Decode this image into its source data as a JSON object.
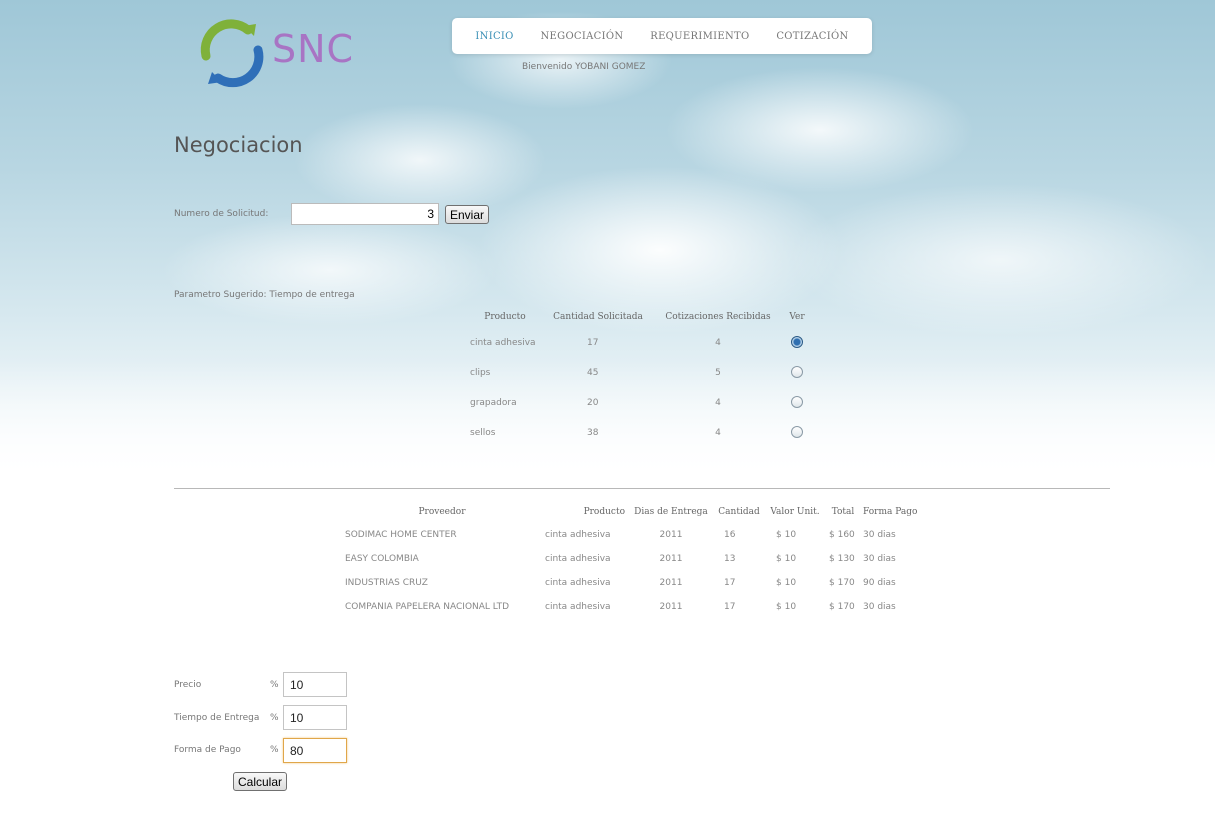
{
  "logo": {
    "text": "SNC"
  },
  "nav": {
    "items": [
      {
        "label": "INICIO",
        "active": true
      },
      {
        "label": "NEGOCIACIÓN"
      },
      {
        "label": "REQUERIMIENTO"
      },
      {
        "label": "COTIZACIÓN"
      }
    ],
    "welcome": "Bienvenido YOBANI GOMEZ"
  },
  "page": {
    "title": "Negociacion"
  },
  "solicitud": {
    "label": "Numero de Solicitud:",
    "value": "3",
    "button": "Enviar"
  },
  "param": {
    "text": "Parametro Sugerido: Tiempo de entrega"
  },
  "productos": {
    "headers": [
      "Producto",
      "Cantidad Solicitada",
      "Cotizaciones Recibidas",
      "Ver"
    ],
    "rows": [
      {
        "producto": "cinta adhesiva",
        "cantidad": "17",
        "cotizaciones": "4",
        "selected": true
      },
      {
        "producto": "clips",
        "cantidad": "45",
        "cotizaciones": "5",
        "selected": false
      },
      {
        "producto": "grapadora",
        "cantidad": "20",
        "cotizaciones": "4",
        "selected": false
      },
      {
        "producto": "sellos",
        "cantidad": "38",
        "cotizaciones": "4",
        "selected": false
      }
    ]
  },
  "cotizaciones": {
    "headers": [
      "Proveedor",
      "Producto",
      "Dias de Entrega",
      "Cantidad",
      "Valor Unit.",
      "Total",
      "Forma Pago"
    ],
    "rows": [
      {
        "proveedor": "SODIMAC HOME CENTER",
        "producto": "cinta adhesiva",
        "dias": "2011",
        "cantidad": "16",
        "valor": "$ 10",
        "total": "$ 160",
        "forma": "30 dias"
      },
      {
        "proveedor": "EASY COLOMBIA",
        "producto": "cinta adhesiva",
        "dias": "2011",
        "cantidad": "13",
        "valor": "$ 10",
        "total": "$ 130",
        "forma": "30 dias"
      },
      {
        "proveedor": "INDUSTRIAS CRUZ",
        "producto": "cinta adhesiva",
        "dias": "2011",
        "cantidad": "17",
        "valor": "$ 10",
        "total": "$ 170",
        "forma": "90 dias"
      },
      {
        "proveedor": "COMPANIA PAPELERA NACIONAL LTD",
        "producto": "cinta adhesiva",
        "dias": "2011",
        "cantidad": "17",
        "valor": "$ 10",
        "total": "$ 170",
        "forma": "30 dias"
      }
    ]
  },
  "ponderacion": {
    "precio_label": "Precio",
    "tiempo_label": "Tiempo de Entrega",
    "forma_label": "Forma de Pago",
    "percent": "%",
    "precio": "10",
    "tiempo": "10",
    "forma": "80",
    "button": "Calcular"
  }
}
